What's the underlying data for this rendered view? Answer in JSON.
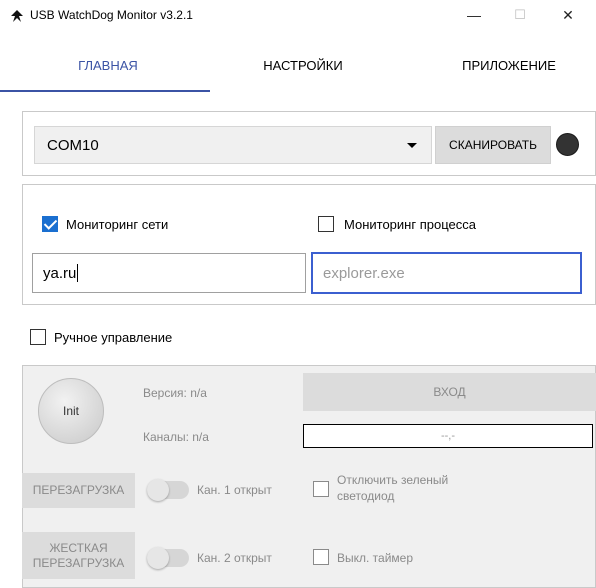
{
  "window": {
    "title": "USB WatchDog Monitor v3.2.1",
    "minimize_glyph": "—",
    "maximize_glyph": "☐",
    "close_glyph": "✕"
  },
  "tabs": [
    {
      "label": "ГЛАВНАЯ",
      "active": true
    },
    {
      "label": "НАСТРОЙКИ",
      "active": false
    },
    {
      "label": "ПРИЛОЖЕНИЕ",
      "active": false
    }
  ],
  "connection": {
    "port_selected": "COM10",
    "scan_button": "СКАНИРОВАТЬ",
    "status_led_color": "#333333"
  },
  "monitoring": {
    "network": {
      "label": "Мониторинг сети",
      "checked": true,
      "value": "ya.ru"
    },
    "process": {
      "label": "Мониторинг процесса",
      "checked": false,
      "placeholder": "explorer.exe"
    }
  },
  "manual": {
    "label": "Ручное управление",
    "checked": false
  },
  "device": {
    "init_button": "Init",
    "version_label": "Версия: n/a",
    "channels_label": "Каналы: n/a",
    "enter_button": "ВХОД",
    "value_display": "--,-",
    "reboot_button": "ПЕРЕЗАГРУЗКА",
    "hard_reboot_button_line1": "ЖЕСТКАЯ",
    "hard_reboot_button_line2": "ПЕРЕЗАГРУЗКА",
    "channel1_label": "Кан. 1 открыт",
    "channel2_label": "Кан. 2 открыт",
    "disable_led_line1": "Отключить зеленый",
    "disable_led_line2": "светодиод",
    "timer_off_label": "Выкл. таймер"
  },
  "colors": {
    "accent": "#3b53a5",
    "checkbox_checked": "#1a6fd0",
    "disabled_text": "#8a8a8a"
  }
}
